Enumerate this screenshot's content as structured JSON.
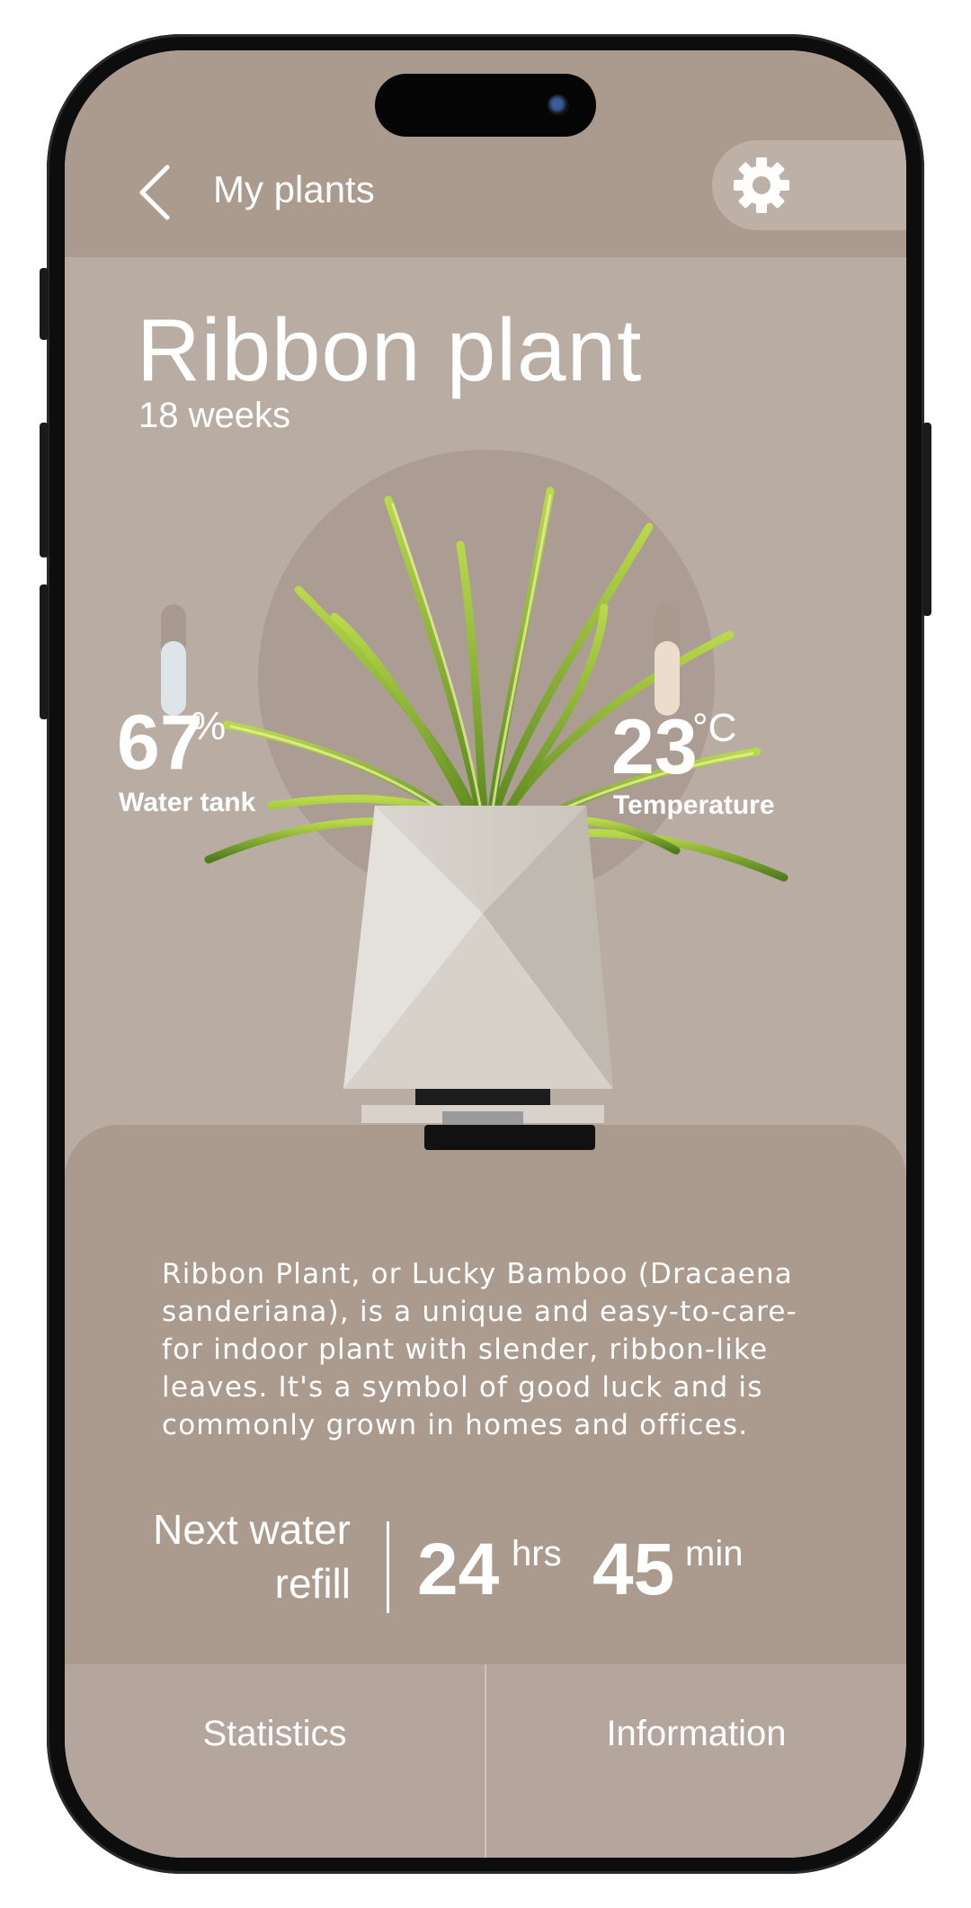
{
  "header": {
    "back_label": "My plants",
    "back_icon": "chevron-left-icon",
    "settings_icon": "gear-icon"
  },
  "plant": {
    "name": "Ribbon plant",
    "age": "18 weeks"
  },
  "metrics": {
    "water": {
      "value": "67",
      "unit": "%",
      "label": "Water tank",
      "level": 0.67,
      "fill_color": "#dde5e8"
    },
    "temperature": {
      "value": "23",
      "unit": "°C",
      "label": "Temperature",
      "level": 0.67,
      "fill_color": "#ecdccb"
    }
  },
  "description": "Ribbon Plant, or Lucky Bamboo (Dracaena sanderiana), is a unique and easy-to-care-for indoor plant with slender, ribbon-like leaves. It's a symbol of good luck and is commonly grown in homes and offices.",
  "refill": {
    "label_line1": "Next water",
    "label_line2": "refill",
    "hours": "24",
    "hours_unit": "hrs",
    "minutes": "45",
    "minutes_unit": "min"
  },
  "nav": {
    "statistics": "Statistics",
    "information": "Information"
  },
  "colors": {
    "screen_bg": "#b9aca3",
    "topbar_bg": "#ab9b8f",
    "card_bg": "#ab9b8f",
    "nav_bg": "#b4a69c",
    "text": "#ffffff"
  }
}
